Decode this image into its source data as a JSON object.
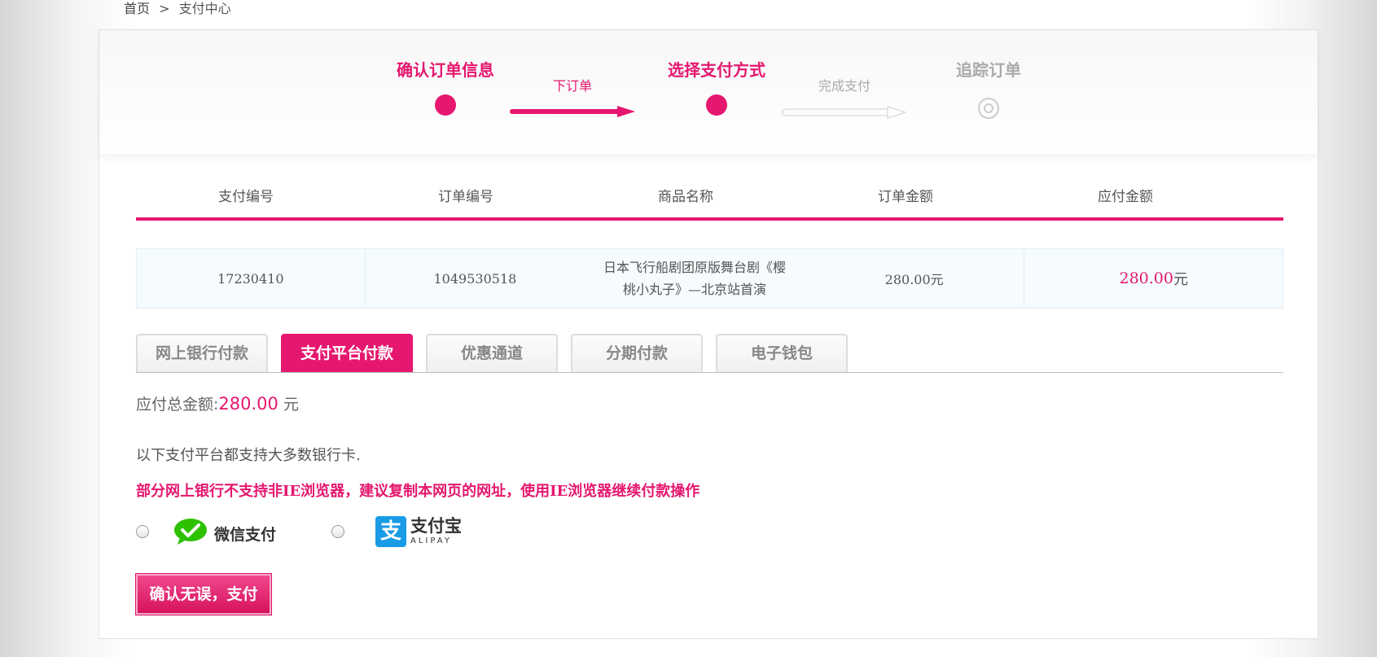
{
  "breadcrumb": {
    "home": "首页",
    "separator": ">",
    "current": "支付中心"
  },
  "steps": [
    {
      "title": "确认订单信息",
      "state": "done"
    },
    {
      "title": "选择支付方式",
      "state": "current"
    },
    {
      "title": "追踪订单",
      "state": "pending"
    }
  ],
  "connectors": [
    {
      "label": "下订单",
      "state": "active"
    },
    {
      "label": "完成支付",
      "state": "inactive"
    }
  ],
  "order_table": {
    "headers": [
      "支付编号",
      "订单编号",
      "商品名称",
      "订单金额",
      "应付金额"
    ],
    "row": {
      "payment_no": "17230410",
      "order_no": "1049530518",
      "product_name": "日本飞行船剧团原版舞台剧《樱桃小丸子》—北京站首演",
      "order_amount": "280.00元",
      "payable_amount": "280.00",
      "payable_unit": "元"
    }
  },
  "tabs": [
    {
      "label": "网上银行付款",
      "active": false
    },
    {
      "label": "支付平台付款",
      "active": true
    },
    {
      "label": "优惠通道",
      "active": false
    },
    {
      "label": "分期付款",
      "active": false
    },
    {
      "label": "电子钱包",
      "active": false
    }
  ],
  "payment": {
    "total_label": "应付总金额:",
    "total_value": "280.00",
    "total_unit": "元",
    "info_text": "以下支付平台都支持大多数银行卡.",
    "warning_text": "部分网上银行不支持非IE浏览器，建议复制本网页的网址，使用IE浏览器继续付款操作",
    "options": [
      {
        "name": "微信支付",
        "icon": "wechat-logo-icon"
      },
      {
        "name": "支付宝",
        "sub": "ALIPAY",
        "icon": "alipay-logo-icon"
      }
    ],
    "confirm_label": "确认无误，支付"
  },
  "colors": {
    "accent": "#e5176f",
    "inactive": "#aaaaaa",
    "alipay_blue": "#1a9be6",
    "wechat_green": "#2dc100"
  }
}
